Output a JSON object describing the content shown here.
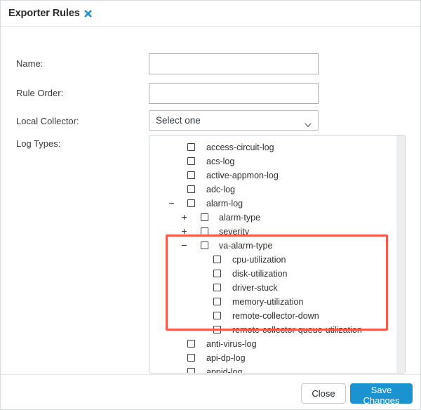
{
  "header": {
    "title": "Exporter Rules",
    "close_icon": "close-x-icon"
  },
  "form": {
    "name": {
      "label": "Name:",
      "value": "",
      "placeholder": ""
    },
    "rule_order": {
      "label": "Rule Order:",
      "value": "",
      "placeholder": ""
    },
    "local_collector": {
      "label": "Local Collector:",
      "selected": "Select one",
      "chevron_icon": "chevron-down-icon"
    },
    "log_types": {
      "label": "Log Types:"
    }
  },
  "tree": [
    {
      "label": "access-circuit-log",
      "depth": 0,
      "toggle": "",
      "checked": false
    },
    {
      "label": "acs-log",
      "depth": 0,
      "toggle": "",
      "checked": false
    },
    {
      "label": "active-appmon-log",
      "depth": 0,
      "toggle": "",
      "checked": false
    },
    {
      "label": "adc-log",
      "depth": 0,
      "toggle": "",
      "checked": false
    },
    {
      "label": "alarm-log",
      "depth": 0,
      "toggle": "−",
      "checked": false
    },
    {
      "label": "alarm-type",
      "depth": 1,
      "toggle": "+",
      "checked": false
    },
    {
      "label": "severity",
      "depth": 1,
      "toggle": "+",
      "checked": false
    },
    {
      "label": "va-alarm-type",
      "depth": 1,
      "toggle": "−",
      "checked": false
    },
    {
      "label": "cpu-utilization",
      "depth": 2,
      "toggle": "",
      "checked": false
    },
    {
      "label": "disk-utilization",
      "depth": 2,
      "toggle": "",
      "checked": false
    },
    {
      "label": "driver-stuck",
      "depth": 2,
      "toggle": "",
      "checked": false
    },
    {
      "label": "memory-utilization",
      "depth": 2,
      "toggle": "",
      "checked": false
    },
    {
      "label": "remote-collector-down",
      "depth": 2,
      "toggle": "",
      "checked": false
    },
    {
      "label": "remote-collector-queue-utilization",
      "depth": 2,
      "toggle": "",
      "checked": false
    },
    {
      "label": "anti-virus-log",
      "depth": 0,
      "toggle": "",
      "checked": false
    },
    {
      "label": "api-dp-log",
      "depth": 0,
      "toggle": "",
      "checked": false
    },
    {
      "label": "appid-log",
      "depth": 0,
      "toggle": "",
      "checked": false
    }
  ],
  "footer": {
    "close_label": "Close",
    "save_label": "Save Changes"
  },
  "colors": {
    "accent_blue": "#1b93d1",
    "highlight_red": "#fb5a4b",
    "text": "#2f2f2f",
    "border": "#cfd4d8",
    "scrollbar_thumb": "#b7babd"
  }
}
